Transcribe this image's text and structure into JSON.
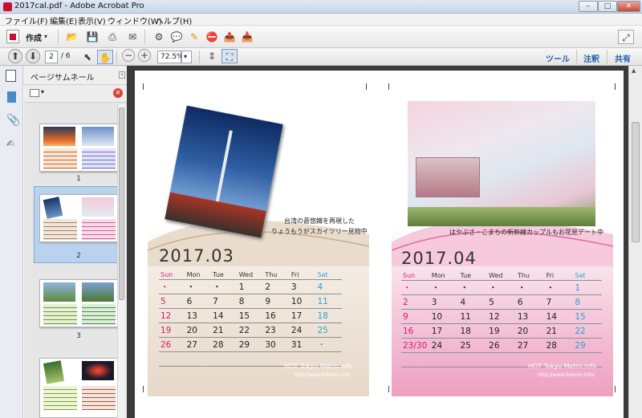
{
  "window": {
    "title": "2017cal.pdf - Adobe Acrobat Pro",
    "controls": [
      "–",
      "□",
      "✕"
    ]
  },
  "menu": [
    "ファイル(F)",
    "編集(E)",
    "表示(V)",
    "ウィンドウ(W)",
    "ヘルプ(H)"
  ],
  "toolbar": {
    "create_label": "作成"
  },
  "nav": {
    "page_current": "2",
    "page_total": "/ 6",
    "zoom": "72.5%"
  },
  "right_links": [
    "ツール",
    "注釈",
    "共有"
  ],
  "panel": {
    "title": "ページサムネール"
  },
  "thumbnails": [
    {
      "label": "1"
    },
    {
      "label": "2"
    },
    {
      "label": "3"
    }
  ],
  "calendars": [
    {
      "month": "2017.03",
      "caption_lines": [
        "台湾の蒼悠鐵を再現した",
        "りょうもうがスカイツリー見物中"
      ],
      "headers": [
        "Sun",
        "Mon",
        "Tue",
        "Wed",
        "Thu",
        "Fri",
        "Sat"
      ],
      "rows": [
        [
          "・",
          "・",
          "・",
          "1",
          "2",
          "3",
          "4"
        ],
        [
          "5",
          "6",
          "7",
          "8",
          "9",
          "10",
          "11"
        ],
        [
          "12",
          "13",
          "14",
          "15",
          "16",
          "17",
          "18"
        ],
        [
          "19",
          "20",
          "21",
          "22",
          "23",
          "24",
          "25"
        ],
        [
          "26",
          "27",
          "28",
          "29",
          "30",
          "31",
          "・"
        ],
        [
          "",
          "",
          "",
          "",
          "",
          "",
          ""
        ]
      ],
      "brand": "HOT Tokyo Metro.info",
      "url": "http://www.hotmm.info/"
    },
    {
      "month": "2017.04",
      "caption_lines": [
        "はやぶさ・こまちの新幹線カップルもお花見デート中"
      ],
      "headers": [
        "Sun",
        "Mon",
        "Tue",
        "Wed",
        "Thu",
        "Fri",
        "Sat"
      ],
      "rows": [
        [
          "・",
          "・",
          "・",
          "・",
          "・",
          "・",
          "1"
        ],
        [
          "2",
          "3",
          "4",
          "5",
          "6",
          "7",
          "8"
        ],
        [
          "9",
          "10",
          "11",
          "12",
          "13",
          "14",
          "15"
        ],
        [
          "16",
          "17",
          "18",
          "19",
          "20",
          "21",
          "22"
        ],
        [
          "23/30",
          "24",
          "25",
          "26",
          "27",
          "28",
          "29"
        ],
        [
          "",
          "",
          "",
          "",
          "",
          "",
          ""
        ]
      ],
      "brand": "HOT Tokyo Metro.info",
      "url": "http://www.hotmm.info/"
    }
  ],
  "colors": {
    "sunday": "#d9197b",
    "saturday": "#2a9fd6",
    "selection": "#b9d3ef"
  }
}
